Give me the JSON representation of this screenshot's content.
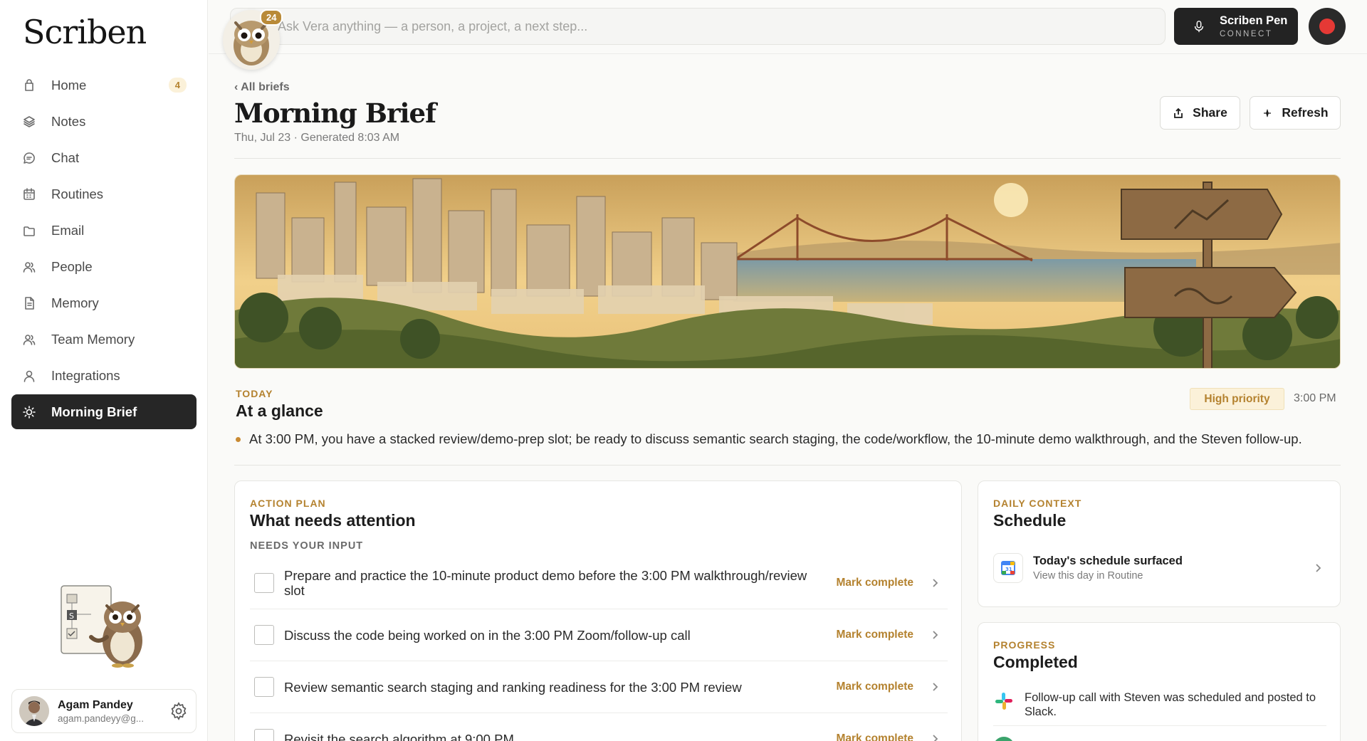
{
  "app": {
    "logo": "Scriben"
  },
  "sidebar": {
    "items": [
      {
        "label": "Home",
        "icon": "home-icon",
        "badge": "4"
      },
      {
        "label": "Notes",
        "icon": "layers-icon"
      },
      {
        "label": "Chat",
        "icon": "chat-bubble-icon"
      },
      {
        "label": "Routines",
        "icon": "calendar-icon"
      },
      {
        "label": "Email",
        "icon": "folder-icon"
      },
      {
        "label": "People",
        "icon": "people-icon"
      },
      {
        "label": "Memory",
        "icon": "document-icon"
      },
      {
        "label": "Team Memory",
        "icon": "team-icon"
      },
      {
        "label": "Integrations",
        "icon": "user-icon"
      },
      {
        "label": "Morning Brief",
        "icon": "sun-icon",
        "active": true
      }
    ],
    "user": {
      "name": "Agam Pandey",
      "email": "agam.pandeyy@g..."
    }
  },
  "topbar": {
    "search_placeholder": "Ask Vera anything — a person, a project, a next step...",
    "owl_badge": "24",
    "pen_title": "Scriben Pen",
    "pen_sub": "CONNECT",
    "record_color": "#e53935"
  },
  "header": {
    "back": "‹ All briefs",
    "title": "Morning Brief",
    "subtitle": "Thu, Jul 23 · Generated 8:03 AM",
    "share": "Share",
    "refresh": "Refresh"
  },
  "glance": {
    "eyebrow": "TODAY",
    "title": "At a glance",
    "priority": "High priority",
    "time": "3:00 PM",
    "bullet": "At 3:00 PM, you have a stacked review/demo-prep slot; be ready to discuss semantic search staging, the code/workflow, the 10-minute demo walkthrough, and the Steven follow-up."
  },
  "action_plan": {
    "eyebrow": "ACTION PLAN",
    "title": "What needs attention",
    "section": "NEEDS YOUR INPUT",
    "mark_label": "Mark complete",
    "tasks": [
      "Prepare and practice the 10-minute product demo before the 3:00 PM walkthrough/review slot",
      "Discuss the code being worked on in the 3:00 PM Zoom/follow-up call",
      "Review semantic search staging and ranking readiness for the 3:00 PM review",
      "Revisit the search algorithm at 9:00 PM"
    ]
  },
  "daily_context": {
    "eyebrow": "DAILY CONTEXT",
    "title": "Schedule",
    "item_title": "Today's schedule surfaced",
    "item_sub": "View this day in Routine"
  },
  "progress": {
    "eyebrow": "PROGRESS",
    "title": "Completed",
    "item": "Follow-up call with Steven was scheduled and posted to Slack."
  },
  "colors": {
    "accent": "#b4822f",
    "dark": "#262626",
    "priority_bg": "#fbf1d9"
  }
}
